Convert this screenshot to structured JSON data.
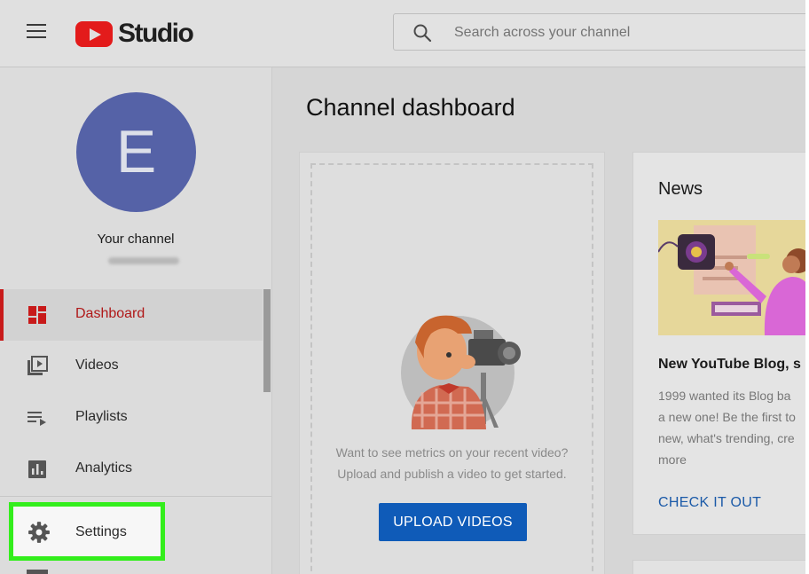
{
  "header": {
    "logo_text": "Studio",
    "search": {
      "placeholder": "Search across your channel",
      "value": ""
    }
  },
  "sidebar": {
    "avatar_letter": "E",
    "channel_label": "Your channel",
    "items": [
      {
        "label": "Dashboard",
        "icon": "dashboard-icon",
        "active": true
      },
      {
        "label": "Videos",
        "icon": "videos-icon"
      },
      {
        "label": "Playlists",
        "icon": "playlists-icon"
      },
      {
        "label": "Analytics",
        "icon": "analytics-icon"
      },
      {
        "label": "Settings",
        "icon": "gear-icon",
        "highlighted": true
      }
    ]
  },
  "main": {
    "title": "Channel dashboard",
    "upload_card": {
      "message_line1": "Want to see metrics on your recent video?",
      "message_line2": "Upload and publish a video to get started.",
      "button_label": "UPLOAD VIDEOS"
    },
    "news_card": {
      "title": "News",
      "headline": "New YouTube Blog, s",
      "body": "1999 wanted its Blog ba\na new one! Be the first to\nnew, what's trending, cre\nmore",
      "link_label": "CHECK IT OUT"
    }
  },
  "colors": {
    "brand_red": "#e31b1b",
    "accent_active": "#c81a1a",
    "primary_button": "#0f5bb8",
    "link": "#1b5aa8",
    "highlight_box": "#33ee1c",
    "avatar_bg": "#5562a7"
  }
}
